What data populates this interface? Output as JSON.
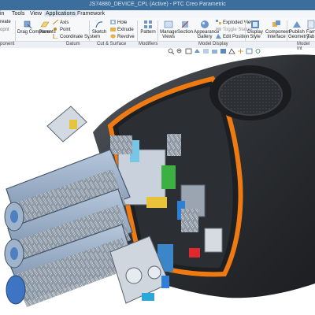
{
  "window": {
    "title": "JS74880_DEVICE_CPL (Active) - PTC Creo Parametric"
  },
  "menu": {
    "items": [
      "in",
      "Tools",
      "View",
      "Applications",
      "Framework"
    ],
    "active_index": 3
  },
  "ribbon": {
    "create_label": "reate",
    "paste_label": "opnt",
    "drag_label": "Drag Components",
    "plane_label": "Plane",
    "axis_label": "Axis",
    "point_label": "Point",
    "coordinate_system_label": "Coordinate System",
    "sketch_label": "Sketch",
    "hole_label": "Hole",
    "extrude_label": "Extrude",
    "revolve_label": "Revolve",
    "pattern_label": "Pattern",
    "manage_views_label": "Manage Views",
    "section_label": "Section",
    "appearance_gallery_label": "Appearance Gallery",
    "exploded_view_label": "Exploded View",
    "toggle_status_label": "Toggle Status",
    "edit_position_label": "Edit Position",
    "display_style_label": "Display Style",
    "component_interface_label": "Component Interface",
    "publish_geometry_label": "Publish Geometry",
    "family_table_label": "Fam Tab"
  },
  "groups": {
    "component_label": "ponent",
    "datum_label": "Datum",
    "cut_surface_label": "Cut & Surface",
    "modifiers_label": "Modifiers",
    "model_display_label": "Model Display",
    "model_intent_label": "Model Int"
  },
  "colors": {
    "title_bar": "#3b6e9d",
    "ribbon": "#f7f8fa",
    "housing": "#2a2d31",
    "accent_orange": "#ef7a12"
  }
}
